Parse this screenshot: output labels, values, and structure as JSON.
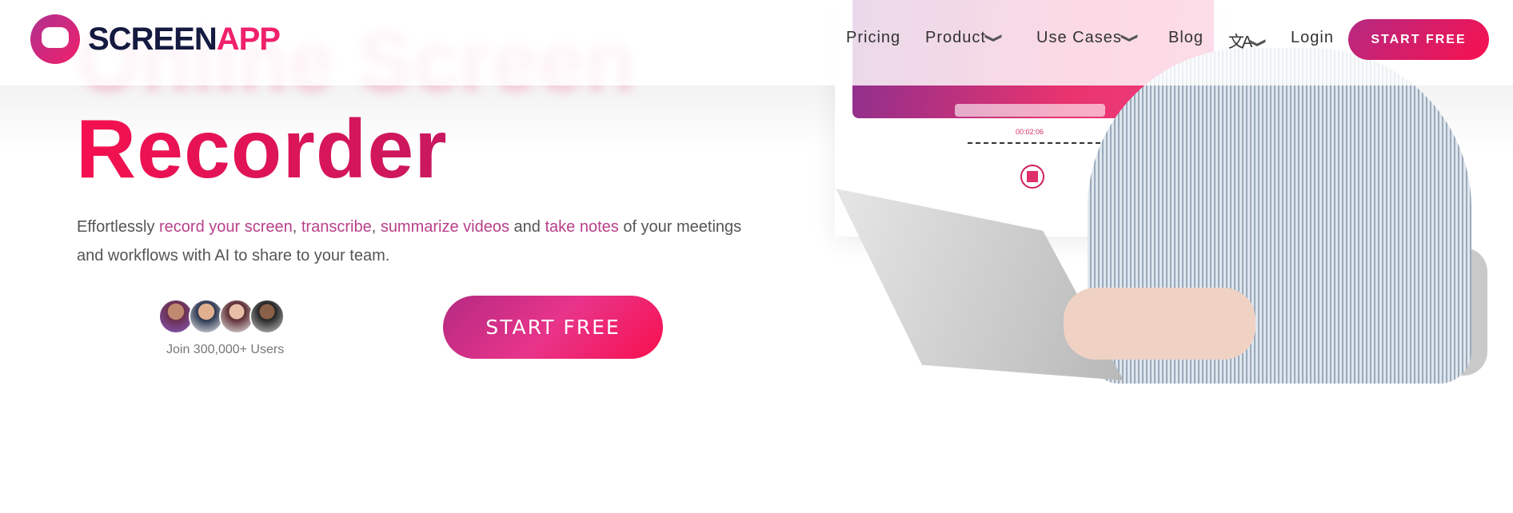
{
  "header": {
    "logo_text_a": "SCREEN",
    "logo_text_b": "APP",
    "nav": [
      {
        "label": "Pricing"
      },
      {
        "label": "Product",
        "icon": "chevron-down-icon"
      },
      {
        "label": "Use Cases",
        "icon": "chevron-down-icon"
      },
      {
        "label": "Blog"
      },
      {
        "label": "文A",
        "icon": "translate-icon"
      },
      {
        "label": "Login"
      }
    ],
    "cta": "START FREE"
  },
  "hero": {
    "title_blurred": "Online Screen",
    "title": "Recorder",
    "desc": {
      "t1": "Effortlessly ",
      "l1": "record your screen",
      "t2": ", ",
      "l2": "transcribe",
      "t3": ", ",
      "l3": "summarize videos",
      "t4": " and ",
      "l4": "take notes",
      "t5": " of your meetings and workflows with AI to share to your team."
    },
    "join": "Join 300,000+ Users",
    "cta": "START FREE",
    "recording_timer": "00:02:06"
  },
  "colors": {
    "accent": "#f0206a",
    "brand_dark": "#151a40",
    "link": "#b9408a"
  }
}
